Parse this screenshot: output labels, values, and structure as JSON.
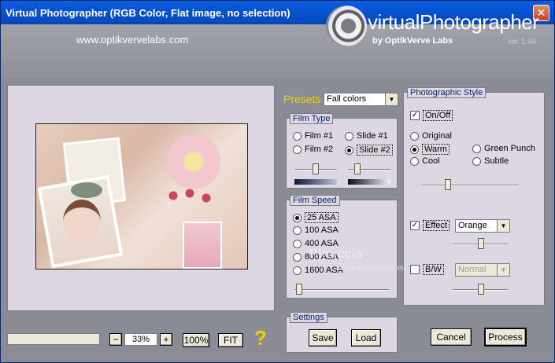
{
  "window": {
    "title": "Virtual Photographer (RGB Color, Flat image, no selection)",
    "close_glyph": "✕"
  },
  "header": {
    "url": "www.optikvervelabs.com",
    "logo_text": "virtualPhotographer",
    "logo_sub": "by OptikVerve Labs",
    "version": "ver 1.44"
  },
  "watermark": {
    "line1": "Pinuccia",
    "line2": "www.ipiregrafica.eu"
  },
  "zoom": {
    "minus": "−",
    "value": "33%",
    "plus": "+",
    "fit_100": "100%",
    "fit": "FIT",
    "help": "?"
  },
  "presets": {
    "label": "Presets",
    "selected": "Fall colors"
  },
  "film_type": {
    "title": "Film Type",
    "options": [
      "Film #1",
      "Film #2",
      "Slide #1",
      "Slide #2"
    ],
    "selected": "Slide #2"
  },
  "film_speed": {
    "title": "Film Speed",
    "options": [
      "25 ASA",
      "100 ASA",
      "400 ASA",
      "800 ASA",
      "1600 ASA"
    ],
    "selected": "25 ASA"
  },
  "settings": {
    "title": "Settings",
    "save": "Save",
    "load": "Load"
  },
  "photographic_style": {
    "title": "Photographic Style",
    "onoff": "On/Off",
    "onoff_checked": true,
    "styles": [
      "Original",
      "Warm",
      "Cool",
      "Green Punch",
      "Subtle"
    ],
    "selected": "Warm",
    "effect_label": "Effect",
    "effect_checked": true,
    "effect_value": "Orange",
    "bw_label": "B/W",
    "bw_checked": false,
    "bw_value": "Normal"
  },
  "actions": {
    "cancel": "Cancel",
    "process": "Process"
  },
  "colors": {
    "title_bar": "#0653d2",
    "accent_yellow": "#f3d000",
    "panel": "#dcd7e3"
  }
}
